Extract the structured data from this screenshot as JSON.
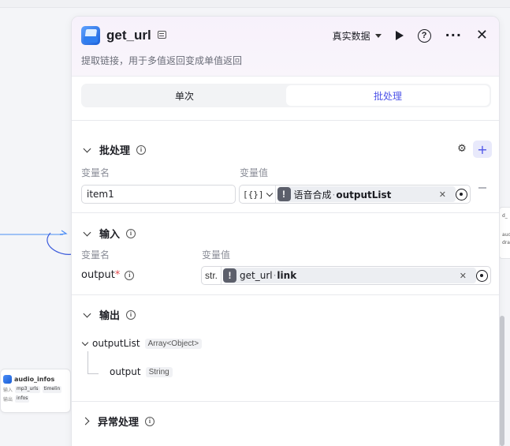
{
  "canvas": {
    "mini_node": {
      "title": "audio_infos",
      "input_label": "输入",
      "input_tags": [
        "mp3_urls",
        "timelin"
      ],
      "output_label": "输出",
      "output_tag": "infos"
    },
    "right_node_lines": [
      "d_",
      "aud",
      "dra"
    ]
  },
  "panel": {
    "title": "get_url",
    "description": "提取链接，用于多值返回变成单值返回",
    "data_mode": "真实数据",
    "tabs": [
      {
        "label": "单次",
        "active": false
      },
      {
        "label": "批处理",
        "active": true
      }
    ],
    "batch": {
      "title": "批处理",
      "col_name": "变量名",
      "col_value": "变量值",
      "row": {
        "name": "item1",
        "type_glyph": "[{}]",
        "ref_node": "语音合成",
        "ref_field": "outputList"
      }
    },
    "input": {
      "title": "输入",
      "col_name": "变量名",
      "col_value": "变量值",
      "field": {
        "name": "output",
        "required_mark": "*",
        "type_tag": "str.",
        "ref_node": "get_url",
        "ref_field": "link"
      }
    },
    "output": {
      "title": "输出",
      "list_name": "outputList",
      "list_type": "Array<Object>",
      "child_name": "output",
      "child_type": "String"
    },
    "exception": {
      "title": "异常处理"
    }
  },
  "colors": {
    "accent": "#4d53e8",
    "required": "#e5484d",
    "header_tint": "#f7f1fb"
  }
}
